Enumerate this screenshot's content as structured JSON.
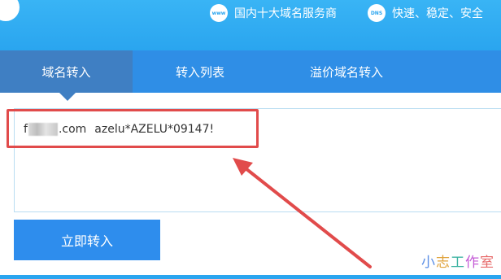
{
  "header": {
    "feature1": {
      "icon_text": "www",
      "label": "国内十大域名服务商"
    },
    "feature2": {
      "icon_text": "DNS",
      "label": "快速、稳定、安全"
    }
  },
  "tabs": [
    {
      "label": "域名转入",
      "active": true
    },
    {
      "label": "转入列表",
      "active": false
    },
    {
      "label": "溢价域名转入",
      "active": false
    }
  ],
  "textarea": {
    "domain_prefix": "f",
    "domain_suffix": ".com",
    "auth_code": "azelu*AZELU*09147!"
  },
  "submit_label": "立即转入",
  "watermark": {
    "chars": [
      {
        "char": "小",
        "color": "#5b8fe6"
      },
      {
        "char": "志",
        "color": "#e0a33c"
      },
      {
        "char": "工",
        "color": "#3cb3a2"
      },
      {
        "char": "作",
        "color": "#c45ad6"
      },
      {
        "char": "室",
        "color": "#e76a6a"
      }
    ]
  },
  "colors": {
    "banner": "#2aa5ef",
    "tab_bar": "#2f8ee6",
    "tab_active": "#3f7fc3",
    "button": "#2e8ded",
    "annotation_red": "#e14b4b"
  }
}
